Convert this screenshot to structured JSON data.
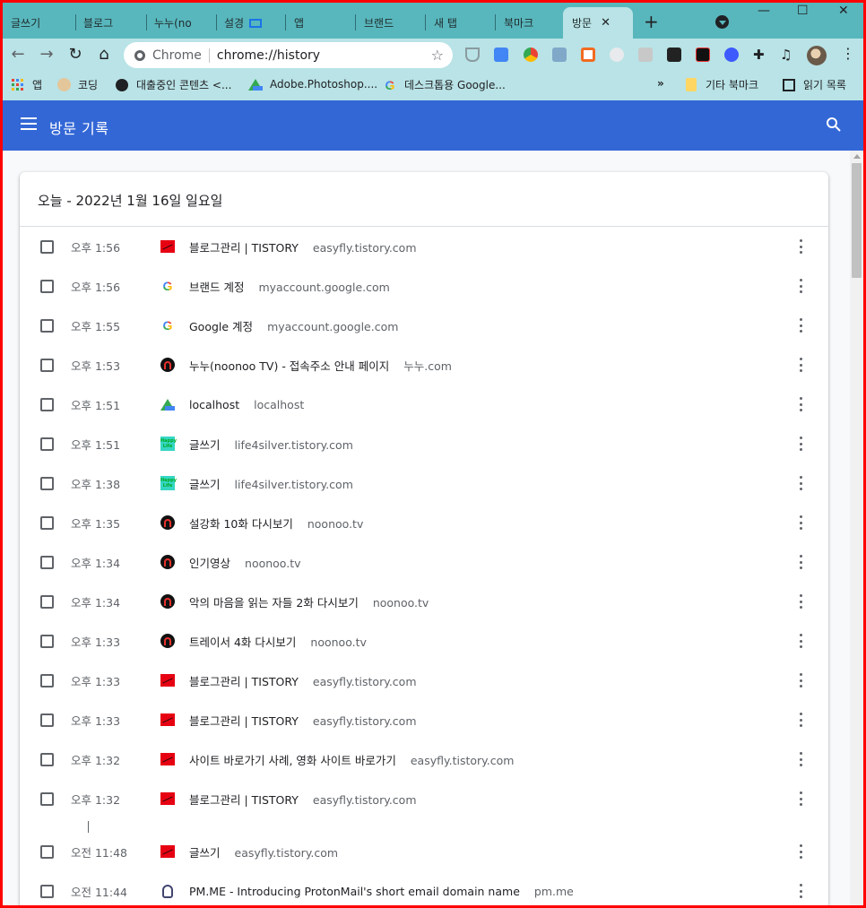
{
  "tabs": [
    {
      "label": "글쓰기",
      "icon": "happy-life-icon"
    },
    {
      "label": "블로그",
      "icon": "tistory-icon"
    },
    {
      "label": "누누(no",
      "icon": "noonoo-icon"
    },
    {
      "label": "설경",
      "icon": "noonoo-icon"
    },
    {
      "label": "앱",
      "icon": "apps-icon"
    },
    {
      "label": "브랜드",
      "icon": "google-icon"
    },
    {
      "label": "새 탭",
      "icon": "chrome-icon"
    },
    {
      "label": "북마크",
      "icon": "star-icon"
    },
    {
      "label": "방문",
      "icon": "history-icon"
    }
  ],
  "window": {
    "minimize": "—",
    "maximize": "☐",
    "close": "✕"
  },
  "toolbar": {
    "chip": "Chrome",
    "url": "chrome://history"
  },
  "bookmarks": {
    "apps": "앱",
    "coding": "코딩",
    "loan": "대출중인 콘텐츠 <...",
    "photoshop": "Adobe.Photoshop....",
    "google": "데스크톱용 Google...",
    "overflow": "»",
    "other": "기타 북마크",
    "reading": "읽기 목록"
  },
  "header": {
    "title": "방문 기록"
  },
  "section": {
    "title": "오늘 - 2022년 1월 16일 일요일"
  },
  "entries": [
    {
      "time": "오후 1:56",
      "title": "블로그관리 | TISTORY",
      "domain": "easyfly.tistory.com",
      "icon": "tistory"
    },
    {
      "time": "오후 1:56",
      "title": "브랜드 계정",
      "domain": "myaccount.google.com",
      "icon": "google"
    },
    {
      "time": "오후 1:55",
      "title": "Google 계정",
      "domain": "myaccount.google.com",
      "icon": "google"
    },
    {
      "time": "오후 1:53",
      "title": "누누(noonoo TV) - 접속주소 안내 페이지",
      "domain": "누누.com",
      "icon": "noonoo"
    },
    {
      "time": "오후 1:51",
      "title": "localhost",
      "domain": "localhost",
      "icon": "drive"
    },
    {
      "time": "오후 1:51",
      "title": "글쓰기",
      "domain": "life4silver.tistory.com",
      "icon": "happy"
    },
    {
      "time": "오후 1:38",
      "title": "글쓰기",
      "domain": "life4silver.tistory.com",
      "icon": "happy"
    },
    {
      "time": "오후 1:35",
      "title": "설강화 10화 다시보기",
      "domain": "noonoo.tv",
      "icon": "noonoo"
    },
    {
      "time": "오후 1:34",
      "title": "인기영상",
      "domain": "noonoo.tv",
      "icon": "noonoo"
    },
    {
      "time": "오후 1:34",
      "title": "악의 마음을 읽는 자들 2화 다시보기",
      "domain": "noonoo.tv",
      "icon": "noonoo"
    },
    {
      "time": "오후 1:33",
      "title": "트레이서 4화 다시보기",
      "domain": "noonoo.tv",
      "icon": "noonoo"
    },
    {
      "time": "오후 1:33",
      "title": "블로그관리 | TISTORY",
      "domain": "easyfly.tistory.com",
      "icon": "tistory"
    },
    {
      "time": "오후 1:33",
      "title": "블로그관리 | TISTORY",
      "domain": "easyfly.tistory.com",
      "icon": "tistory"
    },
    {
      "time": "오후 1:32",
      "title": "사이트 바로가기 사례, 영화 사이트 바로가기",
      "domain": "easyfly.tistory.com",
      "icon": "tistory"
    },
    {
      "time": "오후 1:32",
      "title": "블로그관리 | TISTORY",
      "domain": "easyfly.tistory.com",
      "icon": "tistory"
    },
    {
      "time": "오전 11:48",
      "title": "글쓰기",
      "domain": "easyfly.tistory.com",
      "icon": "tistory"
    },
    {
      "time": "오전 11:44",
      "title": "PM.ME - Introducing ProtonMail's short email domain name",
      "domain": "pm.me",
      "icon": "proton"
    }
  ],
  "colors": {
    "header": "#3367d6",
    "tabstrip": "#58b7bd",
    "toolbar": "#b9e3e6"
  }
}
